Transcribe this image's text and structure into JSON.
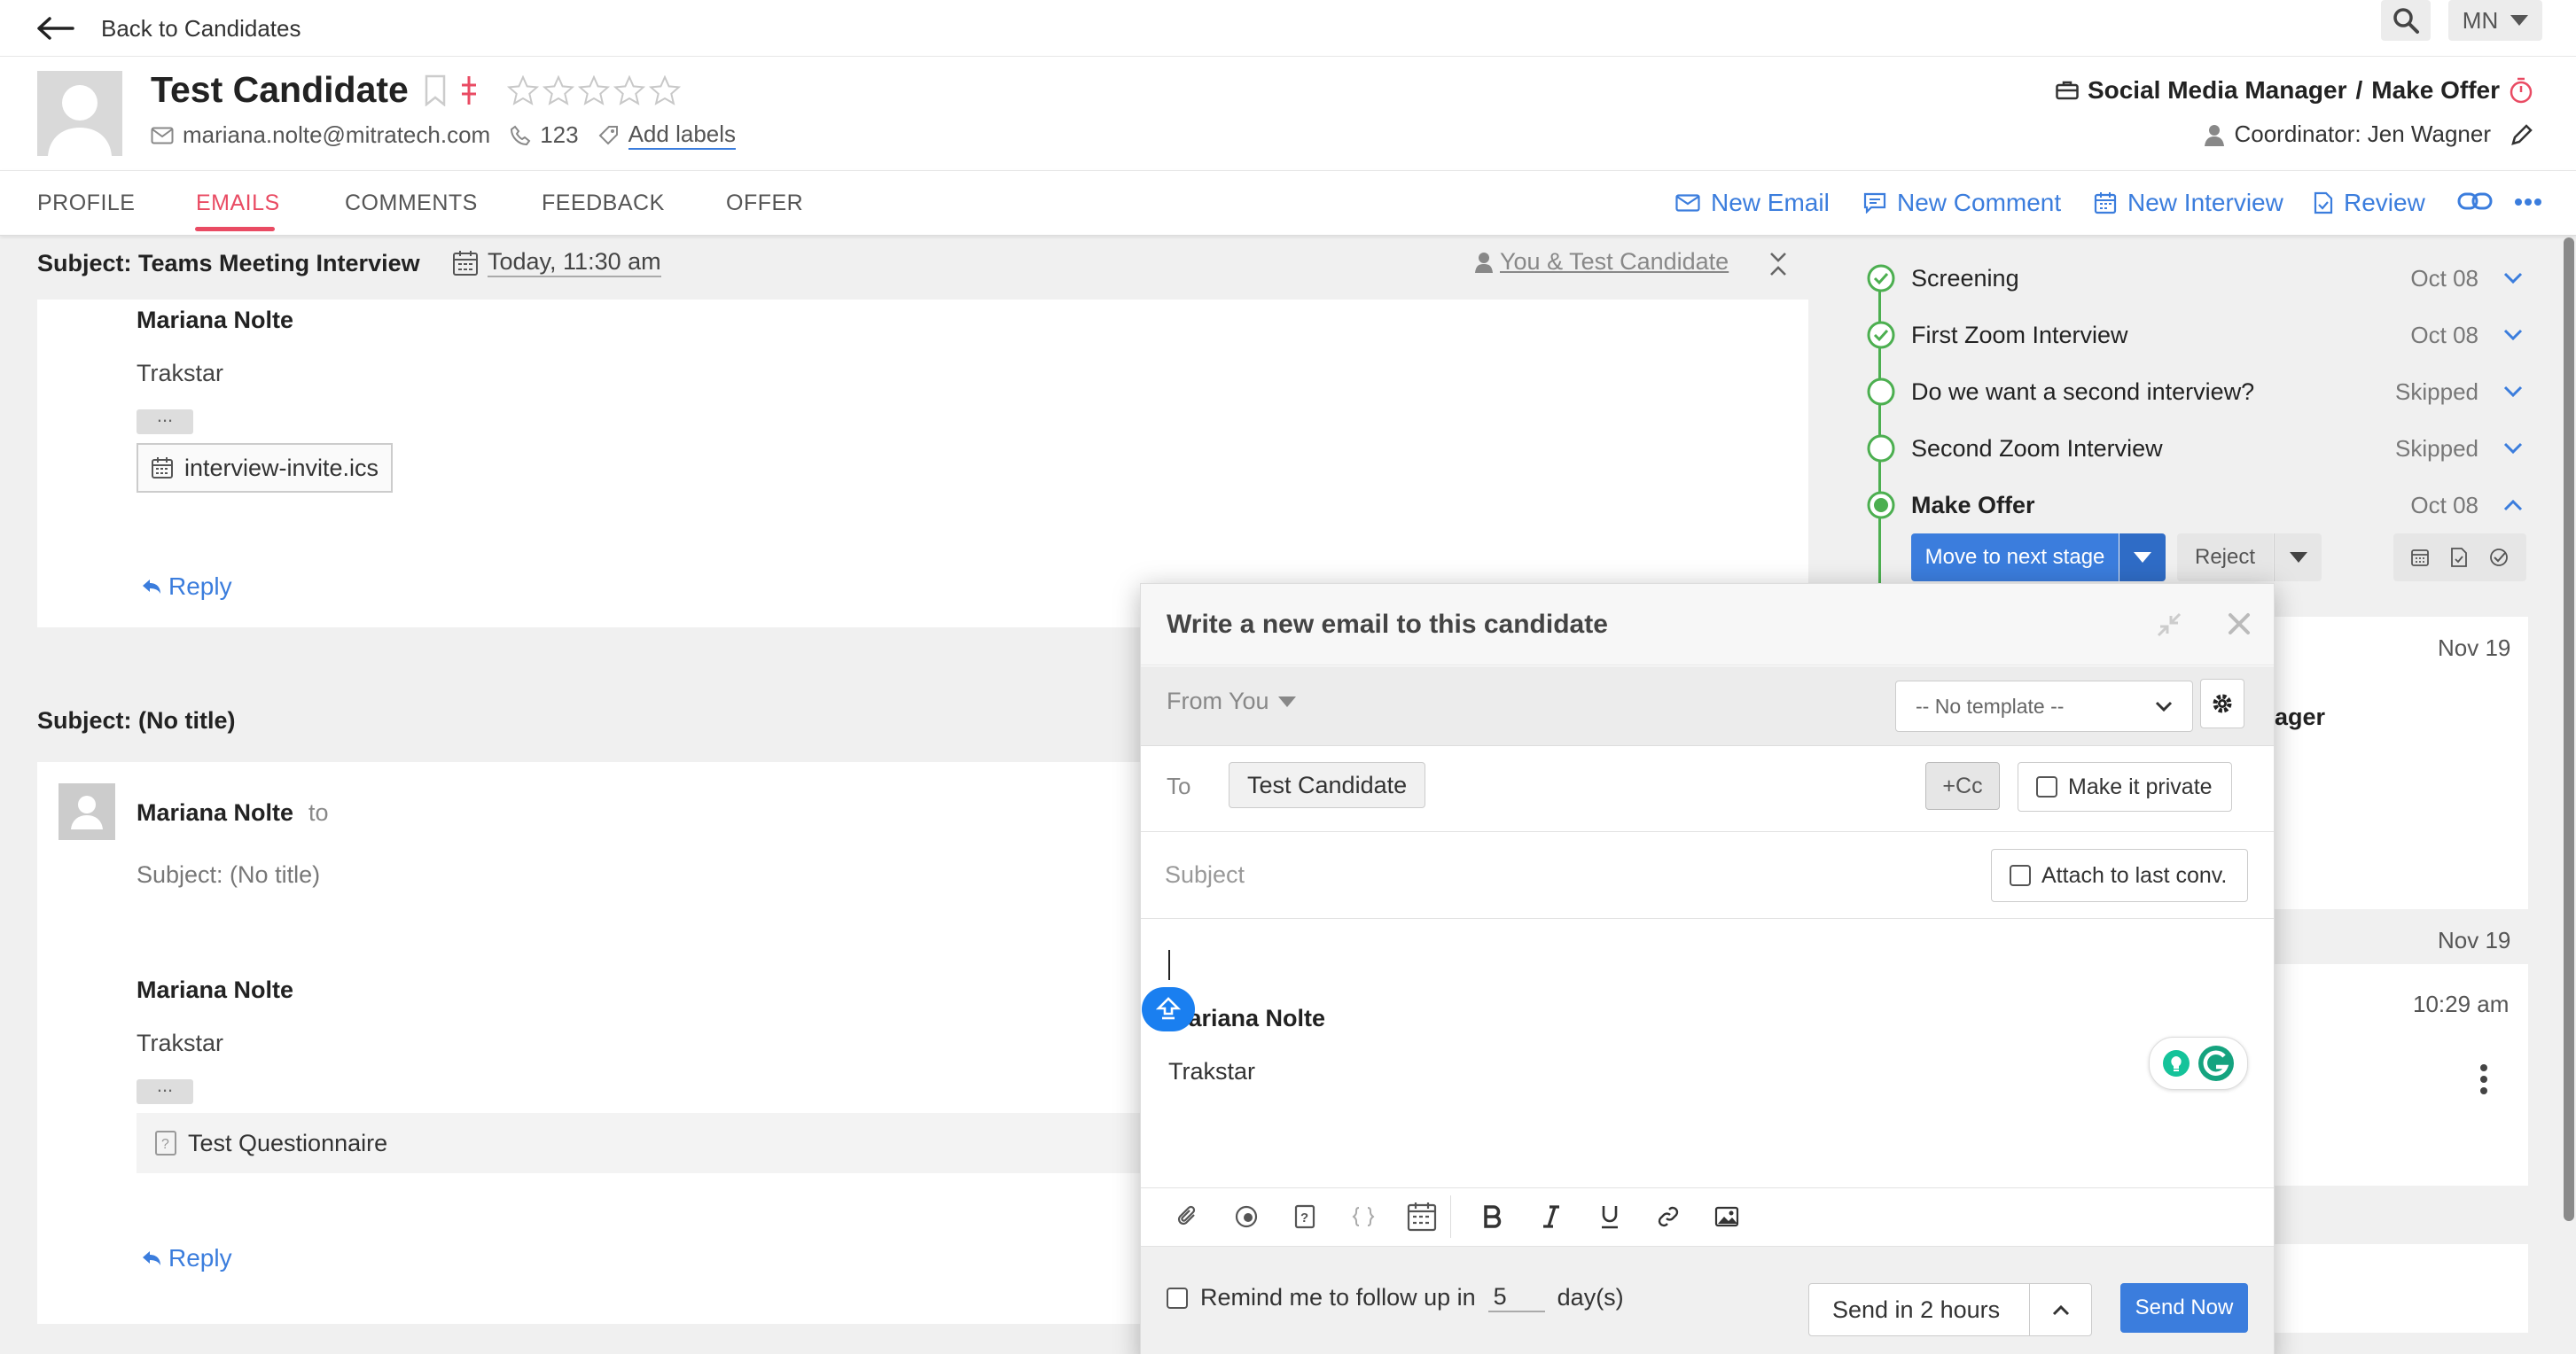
{
  "nav": {
    "back_label": "Back to Candidates",
    "user_initials": "MN"
  },
  "candidate": {
    "name": "Test Candidate",
    "email": "mariana.nolte@mitratech.com",
    "phone": "123",
    "add_labels": "Add labels",
    "rating_stars": 5,
    "job_title": "Social Media Manager",
    "job_separator": "/",
    "job_stage": "Make Offer",
    "coordinator": "Coordinator: Jen Wagner"
  },
  "tabs": [
    {
      "label": "PROFILE"
    },
    {
      "label": "EMAILS"
    },
    {
      "label": "COMMENTS"
    },
    {
      "label": "FEEDBACK"
    },
    {
      "label": "OFFER"
    }
  ],
  "active_tab": "EMAILS",
  "actions": {
    "new_email": "New Email",
    "new_comment": "New Comment",
    "new_interview": "New Interview",
    "review": "Review"
  },
  "emails": [
    {
      "subject": "Subject: Teams Meeting Interview",
      "date": "Today, 11:30 am",
      "participants": "You & Test Candidate",
      "sender": "Mariana Nolte",
      "company": "Trakstar",
      "ellipsis": "...",
      "attachment": "interview-invite.ics",
      "reply": "Reply"
    },
    {
      "subject": "Subject: (No title)",
      "sender": "Mariana Nolte",
      "to": "to",
      "inner_subject": "Subject: (No title)",
      "sig_sender": "Mariana Nolte",
      "company": "Trakstar",
      "ellipsis": "...",
      "attachment": "Test Questionnaire",
      "reply": "Reply"
    }
  ],
  "pipeline": {
    "stages": [
      {
        "name": "Screening",
        "date": "Oct 08",
        "status": "done"
      },
      {
        "name": "First Zoom Interview",
        "date": "Oct 08",
        "status": "done"
      },
      {
        "name": "Do we want a second interview?",
        "date": "Skipped",
        "status": "skipped"
      },
      {
        "name": "Second Zoom Interview",
        "date": "Skipped",
        "status": "skipped"
      },
      {
        "name": "Make Offer",
        "date": "Oct 08",
        "status": "current"
      }
    ],
    "move_next": "Move to next stage",
    "reject": "Reject"
  },
  "feed": {
    "date1": "Nov 19",
    "partial_text": "ager",
    "date2": "Nov 19",
    "time": "10:29 am"
  },
  "compose": {
    "title": "Write a new email to this candidate",
    "from": "From You",
    "template": "-- No template --",
    "to_label": "To",
    "to_recipient": "Test Candidate",
    "cc": "+Cc",
    "make_private": "Make it private",
    "subject_placeholder": "Subject",
    "attach_last": "Attach to last conv.",
    "signature_name": "Mariana Nolte",
    "signature_company": "Trakstar",
    "remind_prefix": "Remind me to follow up in",
    "remind_days": "5",
    "remind_suffix": "day(s)",
    "send_later": "Send in 2 hours",
    "send_now": "Send Now"
  },
  "colors": {
    "accent": "#3b7ddd",
    "active_tab": "#e94b63",
    "success": "#4caf50"
  }
}
